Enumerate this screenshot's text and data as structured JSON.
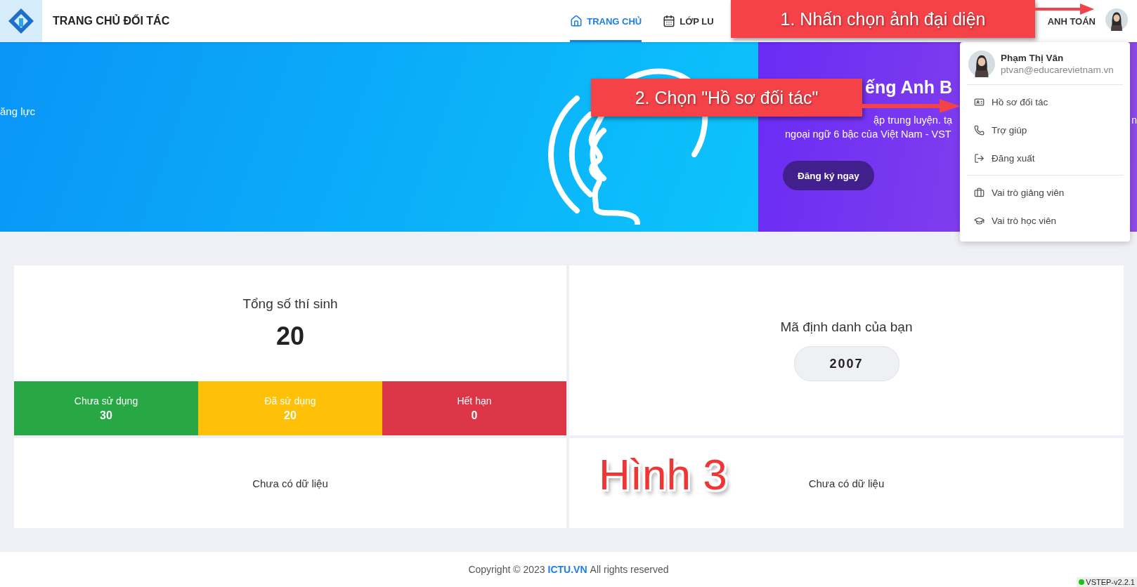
{
  "header": {
    "title": "TRANG CHỦ ĐỐI TÁC",
    "nav": [
      {
        "label": "TRANG CHỦ",
        "kind": "home",
        "selected": true
      },
      {
        "label": "LỚP LU",
        "kind": "calendar",
        "selected": false
      },
      {
        "label": "ANH TOÁN",
        "kind": "text",
        "selected": false
      }
    ]
  },
  "banner": {
    "left_text": "ăng lực",
    "promo": {
      "title": "ếng Anh B",
      "line_1": "ập trung luyện. tạ",
      "line_2": "ngoại ngữ 6 bậc của Việt Nam - VST",
      "edge_text": "n",
      "button": "Đăng ký ngay"
    }
  },
  "user_menu": {
    "name": "Phạm Thị Vân",
    "email": "ptvan@educarevietnam.vn",
    "groups": [
      [
        {
          "label": "Hồ sơ đối tác",
          "kind": "profile"
        },
        {
          "label": "Trợ giúp",
          "kind": "help"
        },
        {
          "label": "Đăng xuất",
          "kind": "logout"
        }
      ],
      [
        {
          "label": "Vai trò giảng viên",
          "kind": "teacher"
        },
        {
          "label": "Vai trò học viên",
          "kind": "student"
        }
      ]
    ]
  },
  "stats": {
    "title": "Tổng số thí sinh",
    "total": "20",
    "statuses": [
      {
        "label": "Chưa sử dụng",
        "value": "30",
        "color": "#28a745"
      },
      {
        "label": "Đã sử dụng",
        "value": "20",
        "color": "#ffc107"
      },
      {
        "label": "Hết hạn",
        "value": "0",
        "color": "#dc3545"
      }
    ]
  },
  "identifier": {
    "title": "Mã định danh của bạn",
    "code": "2007"
  },
  "empty_panels": [
    "Chưa có dữ liệu",
    "Chưa có dữ liệu"
  ],
  "annotations": {
    "callouts": [
      "1. Nhấn chọn ảnh đại diện",
      "2. Chọn \"Hồ sơ đối tác\""
    ],
    "figure_label": "Hình 3"
  },
  "footer": {
    "prefix": "Copyright © 2023",
    "link": "ICTU.VN",
    "suffix": "All rights reserved"
  },
  "version": {
    "label": "VSTEP-v2.2.1",
    "online": true
  }
}
